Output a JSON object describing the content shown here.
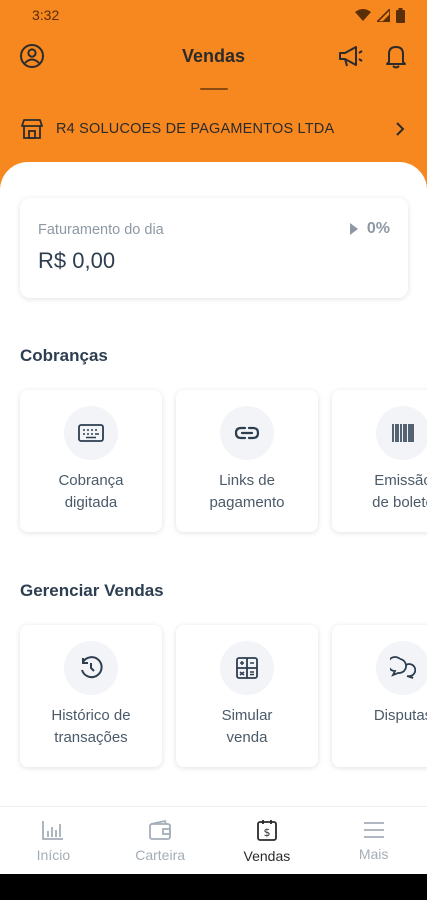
{
  "status_bar": {
    "time": "3:32"
  },
  "header": {
    "title": "Vendas"
  },
  "company": {
    "name": "R4 SOLUCOES DE PAGAMENTOS LTDA"
  },
  "billing": {
    "label": "Faturamento do dia",
    "value": "R$ 0,00",
    "percent": "0%"
  },
  "charges": {
    "title": "Cobranças",
    "items": [
      {
        "label": "Cobrança\ndigitada",
        "icon": "keyboard-icon"
      },
      {
        "label": "Links de\npagamento",
        "icon": "link-icon"
      },
      {
        "label": "Emissão\nde boleto",
        "icon": "barcode-icon"
      }
    ]
  },
  "manage": {
    "title": "Gerenciar Vendas",
    "items": [
      {
        "label": "Histórico de\ntransações",
        "icon": "history-icon"
      },
      {
        "label": "Simular\nvenda",
        "icon": "calculator-icon"
      },
      {
        "label": "Disputas",
        "icon": "chat-icon"
      }
    ]
  },
  "nav": {
    "items": [
      {
        "label": "Início",
        "icon": "chart-icon"
      },
      {
        "label": "Carteira",
        "icon": "wallet-icon"
      },
      {
        "label": "Vendas",
        "icon": "sales-icon"
      },
      {
        "label": "Mais",
        "icon": "menu-icon"
      }
    ],
    "active": "Vendas"
  },
  "colors": {
    "brand": "#F7871F",
    "text": "#2d3e50",
    "muted": "#a4aeb8"
  }
}
